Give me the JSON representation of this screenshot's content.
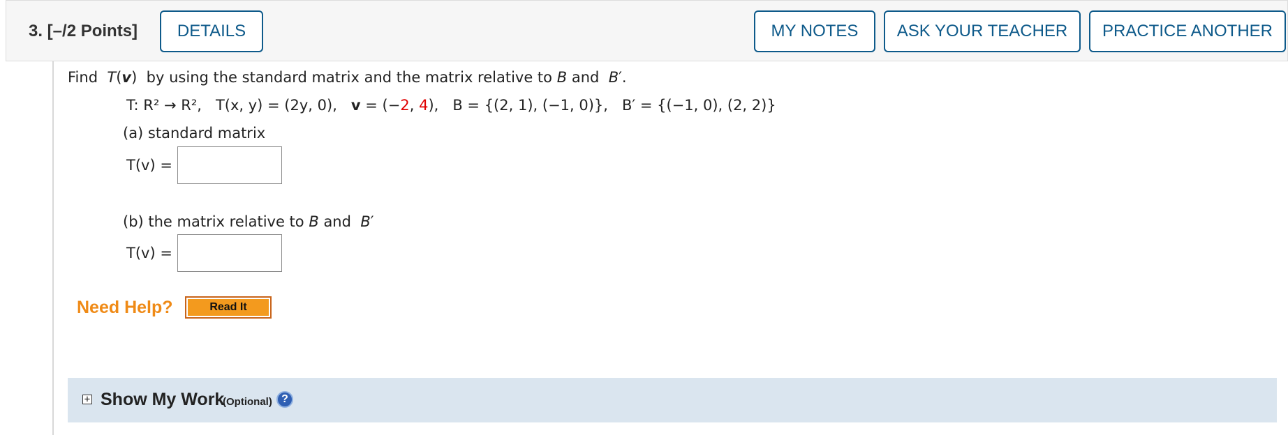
{
  "header": {
    "question": "3.  [–/2 Points]",
    "details": "DETAILS",
    "my_notes": "MY NOTES",
    "ask_teacher": "ASK YOUR TEACHER",
    "practice": "PRACTICE ANOTHER"
  },
  "problem": {
    "prompt": "by using the standard matrix and the matrix relative to",
    "prompt_and": "and",
    "math_prefix": "T: R² → R²,   T(x, y) = (2y, 0),   ",
    "v_open": " = (−",
    "v_x": "2",
    "v_sep": ", ",
    "v_y": "4",
    "math_suffix": "),   B = {(2, 1), (−1, 0)},   B′ = {(−1, 0), (2, 2)}",
    "part_a": "(a) standard matrix",
    "part_b_prefix": "(b) the matrix relative to",
    "part_b_and": "and",
    "answer_label": "T(v) =",
    "answer_a_value": "",
    "answer_b_value": ""
  },
  "help": {
    "need_help": "Need Help?",
    "read_it": "Read It"
  },
  "show_work": {
    "title": "Show My Work",
    "optional": "(Optional)",
    "help_icon": "?"
  },
  "icons": {
    "expand": "plus-box-icon",
    "help": "question-circle-icon"
  },
  "colors": {
    "button_border": "#0e5a8a",
    "need_help": "#ef8a16",
    "read_it_bg": "#f39a1e",
    "show_work_bg": "#dae5ef",
    "randomized_value": "#e00000"
  }
}
